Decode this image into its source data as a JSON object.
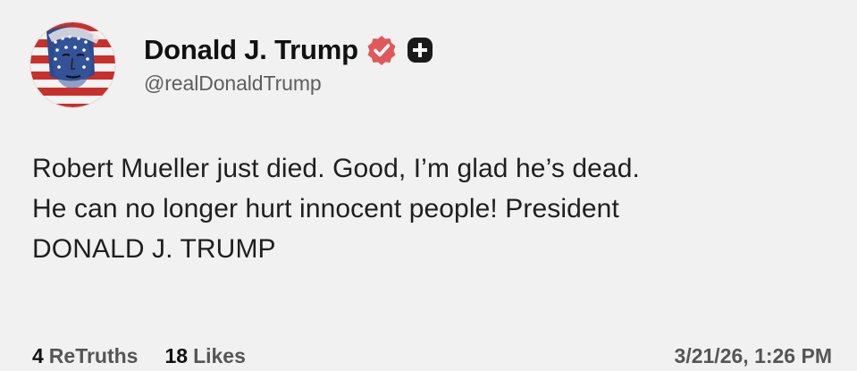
{
  "author": {
    "display_name": "Donald J. Trump",
    "handle": "@realDonaldTrump",
    "verified_icon": "verified-badge-icon",
    "extra_icon": "plus-icon",
    "colors": {
      "verified": "#e0585b",
      "plus_bg": "#1a1a1a"
    }
  },
  "post": {
    "lines": [
      "Robert Mueller just died. Good, I’m glad he’s dead.",
      "He can no longer hurt innocent people! President",
      "DONALD J. TRUMP"
    ]
  },
  "stats": {
    "retruths_count": "4",
    "retruths_label": "ReTruths",
    "likes_count": "18",
    "likes_label": "Likes",
    "timestamp": "3/21/26, 1:26 PM"
  }
}
